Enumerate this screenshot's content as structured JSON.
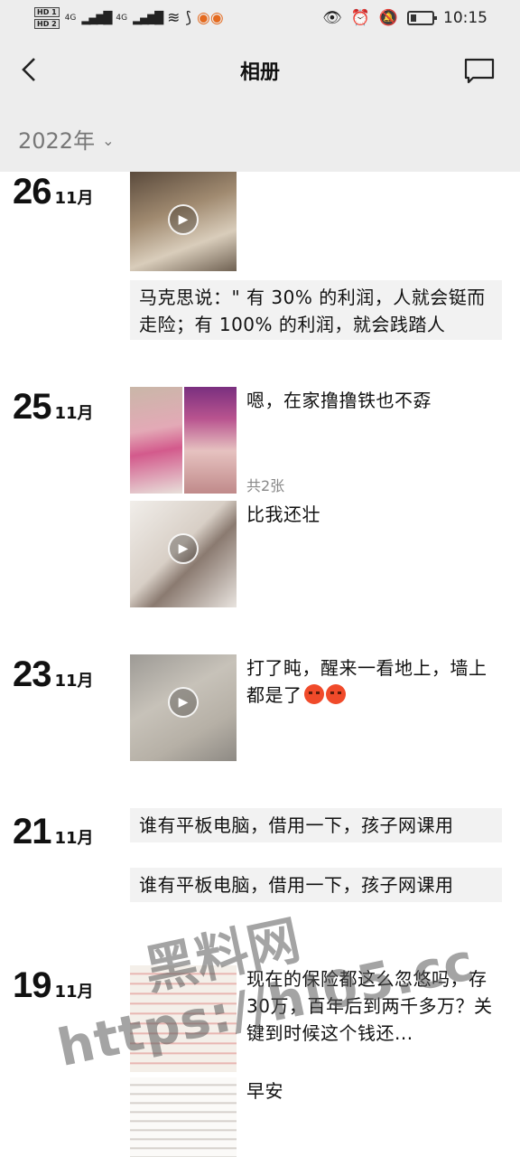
{
  "status_bar": {
    "hd1": "HD 1",
    "hd2": "HD 2",
    "net1": "4G",
    "net2": "4G",
    "time": "10:15"
  },
  "header": {
    "title": "相册"
  },
  "year_filter": {
    "value": "2022年"
  },
  "entries": [
    {
      "day": "26",
      "month": "11月",
      "caption": "马克思说：\" 有 30% 的利润，人就会铤而走险；有 100% 的利润，就会践踏人"
    },
    {
      "day": "25",
      "month": "11月",
      "post1_text": "嗯，在家撸撸铁也不孬",
      "post1_count": "共2张",
      "post2_text": "比我还壮"
    },
    {
      "day": "23",
      "month": "11月",
      "post_text": "打了盹，醒来一看地上，墙上都是了"
    },
    {
      "day": "21",
      "month": "11月",
      "post1_text": "谁有平板电脑，借用一下，孩子网课用",
      "post2_text": "谁有平板电脑，借用一下，孩子网课用"
    },
    {
      "day": "19",
      "month": "11月",
      "post1_text": "现在的保险都这么忽悠吗，存30万，百年后到两千多万？关键到时候这个钱还...",
      "post2_text": "早安"
    }
  ],
  "watermark": {
    "line1": "黑料网",
    "line2": "https://hl05.cc"
  },
  "colors": {
    "bar_bg": "#ededed",
    "text_box_bg": "#f2f2f2",
    "count_gray": "#888888"
  },
  "icons": [
    "back-arrow-icon",
    "message-icon",
    "chevron-down-icon",
    "play-icon"
  ]
}
